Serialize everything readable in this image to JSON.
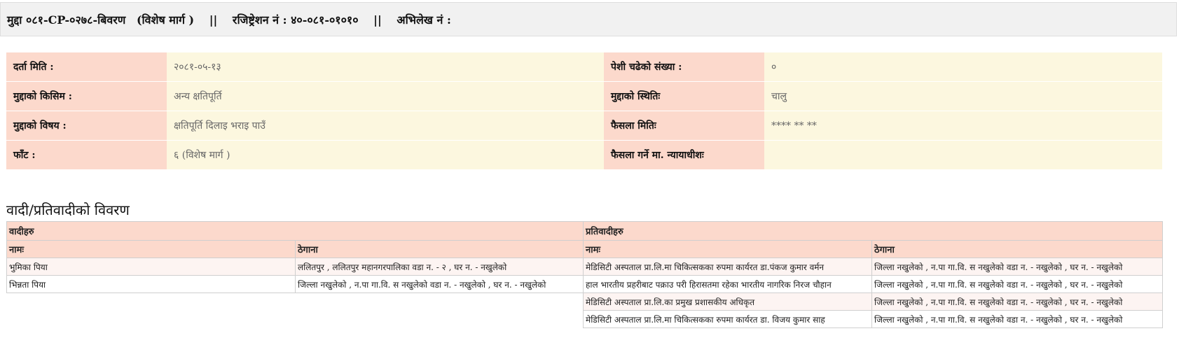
{
  "header": {
    "case_no": "मुद्दा ०८१-CP-०२७८-बिवरण",
    "case_type": "(विशेष मार्ग )",
    "sep": "||",
    "registration": "रजिष्ट्रेशन नं : ४०-०८१-०१०१०",
    "record": "अभिलेख नं :"
  },
  "info": {
    "registration_date_label": "दर्ता मिति :",
    "registration_date": "२०८१-०५-१३",
    "hearing_count_label": "पेशी चढेको संख्या :",
    "hearing_count": "०",
    "case_kind_label": "मुद्दाको किसिम :",
    "case_kind": "अन्य क्षतिपूर्ति",
    "case_status_label": "मुद्दाको स्थितिः",
    "case_status": "चालु",
    "case_subject_label": "मुद्दाको विषय :",
    "case_subject": "क्षतिपूर्ति दिलाइ भराइ पाउँ",
    "decision_date_label": "फैसला मितिः",
    "decision_date": "**** ** **",
    "bench_label": "फाँट :",
    "bench": "६ (विशेष मार्ग )",
    "judge_label": "फैसला गर्ने मा. न्यायाधीशः",
    "judge": ""
  },
  "parties": {
    "title": "वादी/प्रतिवादीको विवरण",
    "plaintiffs_label": "वादीहरु",
    "defendants_label": "प्रतिवादीहरु",
    "name_label": "नामः",
    "address_label": "ठेगाना",
    "plaintiffs": [
      {
        "name": "भुमिका पिया",
        "address": "ललितपुर , ललितपुर महानगरपालिका वडा न. - २ , घर न. - नखुलेको"
      },
      {
        "name": "भिन्नता पिया",
        "address": "जिल्ला नखुलेको , न.पा गा.वि. स नखुलेको वडा न. - नखुलेको , घर न. - नखुलेको"
      }
    ],
    "defendants": [
      {
        "name": "मेडिसिटी अस्पताल प्रा.लि.मा चिकित्सकका रुपमा कार्यरत डा.पंकज कुमार वर्मन",
        "address": "जिल्ला नखुलेको , न.पा गा.वि. स नखुलेको वडा न. - नखुलेको , घर न. - नखुलेको"
      },
      {
        "name": "हाल भारतीय प्रहरीबाट पक्राउ परी हिरासतमा रहेका भारतीय नागरिक निरज चौहान",
        "address": "जिल्ला नखुलेको , न.पा गा.वि. स नखुलेको वडा न. - नखुलेको , घर न. - नखुलेको"
      },
      {
        "name": "मेडिसिटी अस्पताल प्रा.लि.का प्रमुख प्रशासकीय अधिकृत",
        "address": "जिल्ला नखुलेको , न.पा गा.वि. स नखुलेको वडा न. - नखुलेको , घर न. - नखुलेको"
      },
      {
        "name": "मेडिसिटी अस्पताल प्रा.लि.मा चिकित्सकका रुपमा कार्यरत डा. विजय कुमार साह",
        "address": "जिल्ला नखुलेको , न.पा गा.वि. स नखुलेको वडा न. - नखुलेको , घर न. - नखुलेको"
      }
    ]
  }
}
